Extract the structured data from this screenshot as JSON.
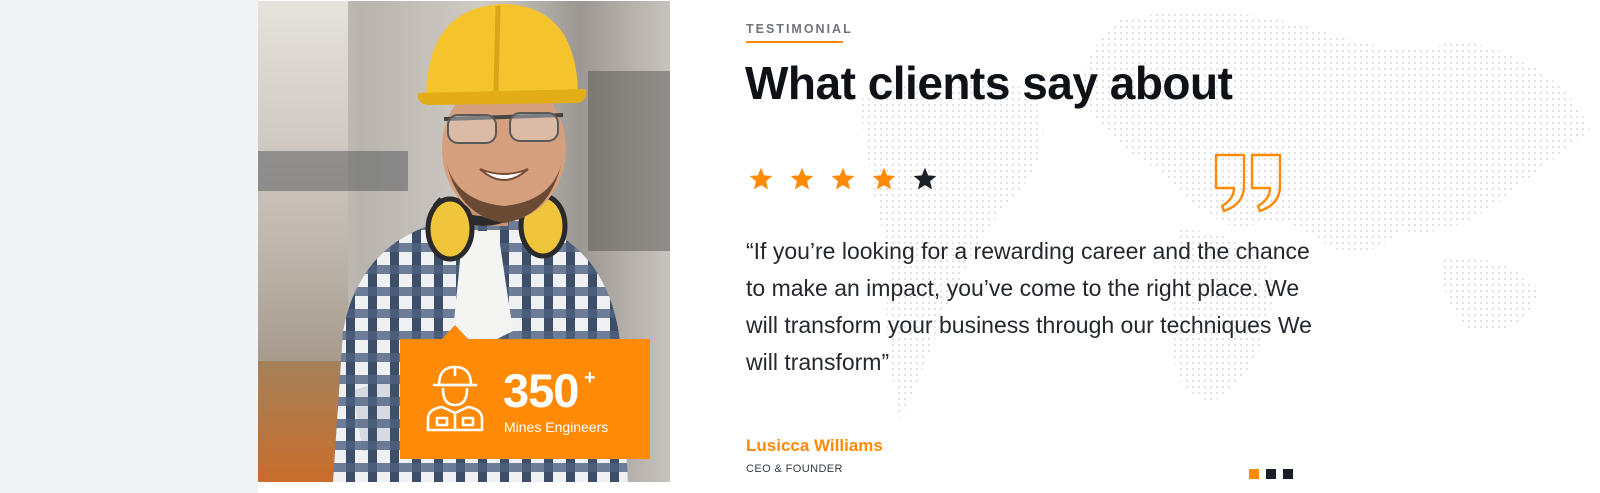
{
  "testimonial": {
    "eyebrow": "TESTIMONIAL",
    "heading": "What clients say about",
    "rating": {
      "value": 4,
      "max": 5
    },
    "quote": "“If you’re looking for a rewarding career and the chance to make an impact, you’ve come to the right place. We will transform your business through our techniques We will transform”",
    "author": {
      "name": "Lusicca Williams",
      "role": "CEO & FOUNDER"
    },
    "slider": {
      "count": 3,
      "active": 0
    }
  },
  "stat": {
    "icon": "engineer-icon",
    "number": "350",
    "suffix": "+",
    "label": "Mines Engineers"
  },
  "colors": {
    "accent": "#ff8a06",
    "dark": "#1a1f27",
    "heading": "#0e1116",
    "side_background": "#f2f3f5"
  },
  "icons": [
    "engineer-icon",
    "star-icon",
    "quote-icon"
  ]
}
